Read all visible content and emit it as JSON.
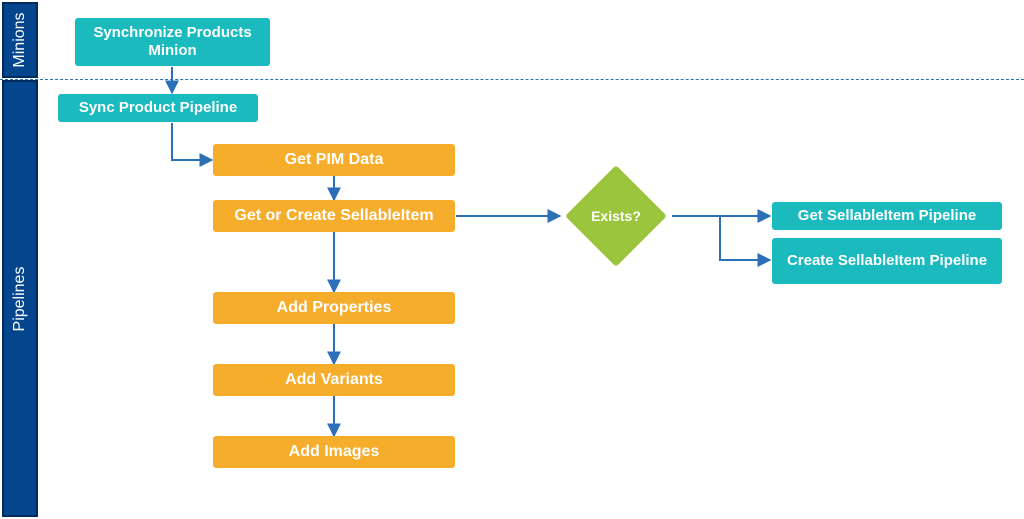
{
  "swimlanes": {
    "minions": "Minions",
    "pipelines": "Pipelines"
  },
  "nodes": {
    "sync_minion": "Synchronize Products Minion",
    "sync_pipeline": "Sync Product Pipeline",
    "get_pim": "Get PIM Data",
    "get_create_si": "Get or Create SellableItem",
    "add_props": "Add Properties",
    "add_variants": "Add Variants",
    "add_images": "Add Images",
    "decision": "Exists?",
    "get_si_pipe": "Get SellableItem Pipeline",
    "create_si_pipe": "Create SellableItem Pipeline"
  },
  "chart_data": {
    "type": "flowchart",
    "title": "",
    "swimlanes": [
      {
        "id": "minions",
        "label": "Minions"
      },
      {
        "id": "pipelines",
        "label": "Pipelines"
      }
    ],
    "nodes": [
      {
        "id": "sync_minion",
        "label": "Synchronize Products Minion",
        "lane": "minions",
        "kind": "process",
        "style": "cyan"
      },
      {
        "id": "sync_pipeline",
        "label": "Sync Product Pipeline",
        "lane": "pipelines",
        "kind": "process",
        "style": "cyan"
      },
      {
        "id": "get_pim",
        "label": "Get PIM Data",
        "lane": "pipelines",
        "kind": "step",
        "style": "orange"
      },
      {
        "id": "get_create_si",
        "label": "Get or Create SellableItem",
        "lane": "pipelines",
        "kind": "step",
        "style": "orange"
      },
      {
        "id": "add_props",
        "label": "Add Properties",
        "lane": "pipelines",
        "kind": "step",
        "style": "orange"
      },
      {
        "id": "add_variants",
        "label": "Add Variants",
        "lane": "pipelines",
        "kind": "step",
        "style": "orange"
      },
      {
        "id": "add_images",
        "label": "Add Images",
        "lane": "pipelines",
        "kind": "step",
        "style": "orange"
      },
      {
        "id": "decision",
        "label": "Exists?",
        "lane": "pipelines",
        "kind": "decision",
        "style": "green"
      },
      {
        "id": "get_si_pipe",
        "label": "Get SellableItem Pipeline",
        "lane": "pipelines",
        "kind": "process",
        "style": "cyan"
      },
      {
        "id": "create_si_pipe",
        "label": "Create SellableItem Pipeline",
        "lane": "pipelines",
        "kind": "process",
        "style": "cyan"
      }
    ],
    "edges": [
      {
        "from": "sync_minion",
        "to": "sync_pipeline"
      },
      {
        "from": "sync_pipeline",
        "to": "get_pim"
      },
      {
        "from": "get_pim",
        "to": "get_create_si"
      },
      {
        "from": "get_create_si",
        "to": "add_props"
      },
      {
        "from": "add_props",
        "to": "add_variants"
      },
      {
        "from": "add_variants",
        "to": "add_images"
      },
      {
        "from": "get_create_si",
        "to": "decision"
      },
      {
        "from": "decision",
        "to": "get_si_pipe"
      },
      {
        "from": "decision",
        "to": "create_si_pipe"
      }
    ],
    "colors": {
      "cyan": "#1ababf",
      "orange": "#f7ad2c",
      "green": "#9bc53c",
      "lane": "#04458d",
      "arrow": "#2a6fb7"
    }
  }
}
